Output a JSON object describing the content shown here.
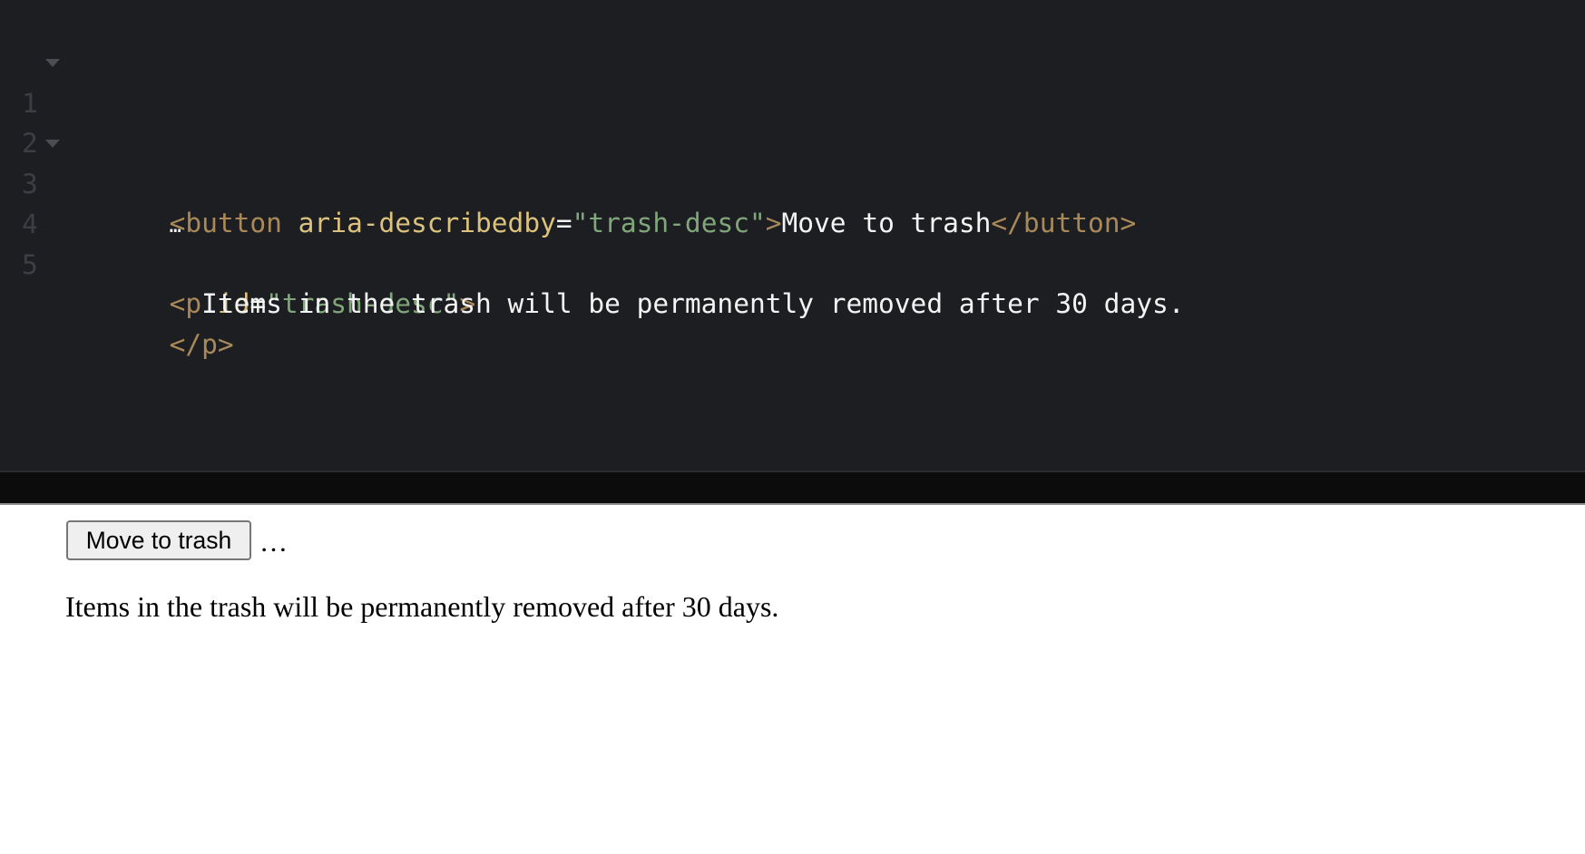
{
  "editor": {
    "language": "html",
    "lines": [
      {
        "number": "1",
        "foldable": true,
        "tokens": [
          {
            "type": "tag",
            "text": "<button"
          },
          {
            "type": "text",
            "text": " "
          },
          {
            "type": "attr",
            "text": "aria-describedby"
          },
          {
            "type": "eq",
            "text": "="
          },
          {
            "type": "str",
            "text": "\"trash-desc\""
          },
          {
            "type": "tag",
            "text": ">"
          },
          {
            "type": "text",
            "text": "Move to trash"
          },
          {
            "type": "tag",
            "text": "</button>"
          }
        ]
      },
      {
        "number": "2",
        "foldable": false,
        "tokens": [
          {
            "type": "ellipsis",
            "text": "…"
          }
        ]
      },
      {
        "number": "3",
        "foldable": true,
        "tokens": [
          {
            "type": "tag",
            "text": "<p"
          },
          {
            "type": "text",
            "text": " "
          },
          {
            "type": "attr",
            "text": "id"
          },
          {
            "type": "eq",
            "text": "="
          },
          {
            "type": "str",
            "text": "\"trash-desc\""
          },
          {
            "type": "tag",
            "text": ">"
          }
        ]
      },
      {
        "number": "4",
        "foldable": false,
        "tokens": [
          {
            "type": "text",
            "text": "  Items in the trash will be permanently removed after 30 days."
          }
        ]
      },
      {
        "number": "5",
        "foldable": false,
        "tokens": [
          {
            "type": "tag",
            "text": "</p>"
          }
        ]
      }
    ],
    "colors": {
      "background": "#1d1e21",
      "line_number": "#3b3e45",
      "tag": "#a9895a",
      "attribute": "#dcc27d",
      "string": "#80a77a",
      "text": "#f4f4f4"
    }
  },
  "preview": {
    "button_label": "Move to trash",
    "ellipsis": "…",
    "description": "Items in the trash will be permanently removed after 30 days."
  }
}
